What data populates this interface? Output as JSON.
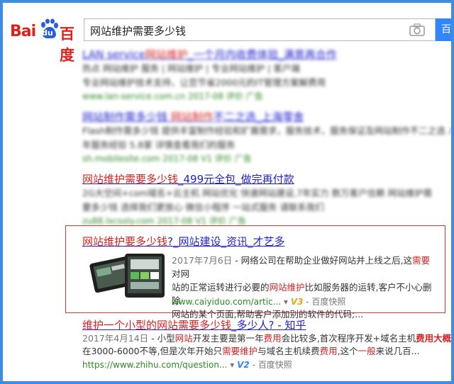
{
  "logo": {
    "bai": "Bai",
    "du": "du",
    "baidu_cn": "百度"
  },
  "search": {
    "query": "网站维护需要多少钱",
    "button_label": "百"
  },
  "results": [
    {
      "title_pre": "LAN service",
      "title_hl": "网站维护",
      "title_post": "_一个月内收费体验_满意再合作",
      "abs1": "热点 网站维护 服务 | 网站维护 | 专业网站维护 | 客户端",
      "abs2": "专业网站维护技术支持，让您节省2000元的IT管理方案解费用",
      "url": "www.lan-service.com.cn  2017-08  评价 广告",
      "blurred": true
    },
    {
      "title_pre": "网站制作需多少钱",
      "title_hl": "网站制作",
      "title_post": "不二之选_上海零舍",
      "abs1": "Flash制作需多少钱 提供丰富制作经验和扩展需求，服务技术，服务保证及网站制作不二之选 八",
      "abs2": "年服务经验 5.8家 详情查看我们的服务",
      "url": "sh.mobilesite.com  2017-08  V1  评价 广告",
      "blurred": true
    },
    {
      "title_pre": "网站维护需要多少钱",
      "title_hl": "",
      "title_post": "_499元全包_做完再付款",
      "abs1": "2G大空间+com域名+云主机 网站优化 快速网站建设,7年实力 数万客户信赖 网站维护需",
      "abs2": "要多少钱 选择我们更放心 微信小程序 一站式服务 请联系我们",
      "url": "zu88.lxcsoly.com  2017-08  V1  评价 广告",
      "blurred": true
    }
  ],
  "highlighted": {
    "title_hl": "网站维护要多少钱",
    "title_post": "?_网站建设_资讯_才艺多",
    "date": "2017年7月6日",
    "line1_a": " - 网络公司在帮助企业做好网站并上线之后,这",
    "line1_hl": "需要",
    "line1_b": "对网",
    "line2_a": "站的正常运转进行必要的",
    "line2_hl": "网站维护",
    "line2_b": "比如服务器的运转,客户不小心删除",
    "line3": "网站的某个页面,帮助客户添加别的软件的代码;...",
    "url": "www.caiyiduo.com/artic...",
    "badge": "V3",
    "snapshot": "百度快照"
  },
  "last": {
    "title_a": "维护一个小型的",
    "title_hl": "网站需要多少钱",
    "title_b": "_多少人? - 知乎",
    "date": "2017年4月14日",
    "l1_a": " - 小型",
    "l1_hl1": "网站",
    "l1_b": "开发主要是第一年",
    "l1_hl2": "费用",
    "l1_c": "会比较多,首次程序开发+域名主机",
    "l1_hl3": "费用大概",
    "l2_a": "在3000-6000不等,但是次年开始只",
    "l2_hl1": "需要维护",
    "l2_b": "与域名主机续费",
    "l2_hl2": "费用",
    "l2_c": ",这个",
    "l2_hl3": "一般",
    "l2_d": "来说几百...",
    "url": "https://www.zhihu.com/question...",
    "badge": "V2",
    "snapshot": "百度快照"
  }
}
